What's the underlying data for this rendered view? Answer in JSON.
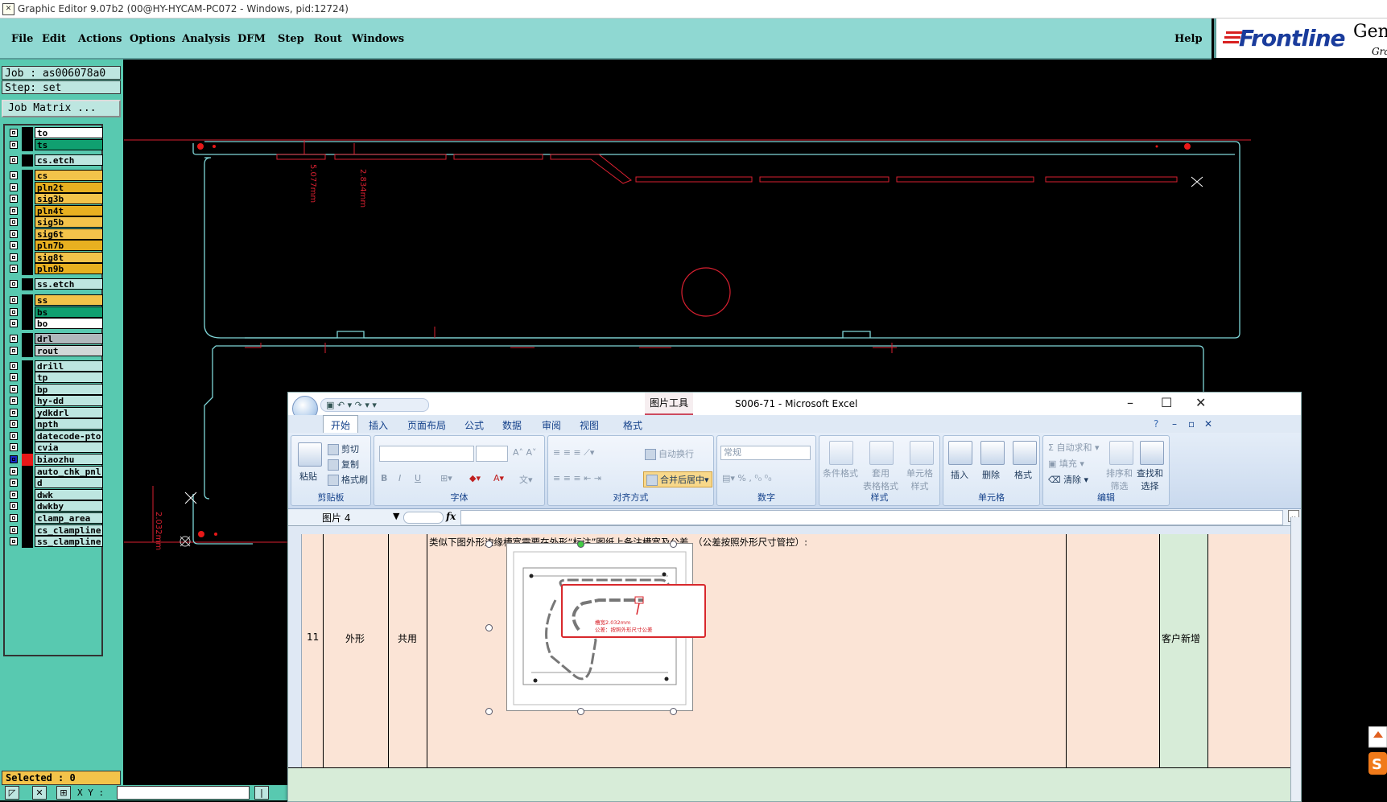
{
  "window": {
    "title": "Graphic Editor 9.07b2 (00@HY-HYCAM-PC072 - Windows, pid:12724)"
  },
  "menu": {
    "items": [
      "File",
      "Edit",
      "Actions",
      "Options",
      "Analysis",
      "DFM",
      "Step",
      "Rout",
      "Windows"
    ],
    "help": "Help"
  },
  "logo": {
    "brand": "Frontline",
    "product": "Gene",
    "sub": "Gra"
  },
  "job": {
    "job_label": "Job : as006078a0",
    "step_label": "Step: set",
    "matrix_button": "Job Matrix ..."
  },
  "layers": [
    {
      "name": "to",
      "color": "#ffffff"
    },
    {
      "name": "ts",
      "color": "#10a070"
    },
    {
      "name": "cs.etch",
      "color": "#bde6e0"
    },
    {
      "name": "cs",
      "color": "#f3c34a"
    },
    {
      "name": "pln2t",
      "color": "#e8b020"
    },
    {
      "name": "sig3b",
      "color": "#f3c34a"
    },
    {
      "name": "pln4t",
      "color": "#e8b020"
    },
    {
      "name": "sig5b",
      "color": "#f3c34a"
    },
    {
      "name": "sig6t",
      "color": "#f3c34a"
    },
    {
      "name": "pln7b",
      "color": "#e8b020"
    },
    {
      "name": "sig8t",
      "color": "#f3c34a"
    },
    {
      "name": "pln9b",
      "color": "#e8b020"
    },
    {
      "name": "ss.etch",
      "color": "#bde6e0"
    },
    {
      "name": "ss",
      "color": "#f3c34a"
    },
    {
      "name": "bs",
      "color": "#10a070"
    },
    {
      "name": "bo",
      "color": "#ffffff"
    },
    {
      "name": "drl",
      "color": "#b0b8bc"
    },
    {
      "name": "rout",
      "color": "#d0d8d8"
    },
    {
      "name": "drill",
      "color": "#bde6e0"
    },
    {
      "name": "tp",
      "color": "#bde6e0"
    },
    {
      "name": "bp",
      "color": "#bde6e0"
    },
    {
      "name": "hy-dd",
      "color": "#bde6e0"
    },
    {
      "name": "ydkdrl",
      "color": "#bde6e0"
    },
    {
      "name": "npth",
      "color": "#bde6e0"
    },
    {
      "name": "datecode-pto",
      "color": "#bde6e0"
    },
    {
      "name": "cvia",
      "color": "#bde6e0"
    },
    {
      "name": "biaozhu",
      "color": "#bde6e0",
      "active": true
    },
    {
      "name": "auto_chk_pnl",
      "color": "#bde6e0"
    },
    {
      "name": "d",
      "color": "#bde6e0"
    },
    {
      "name": "dwk",
      "color": "#bde6e0"
    },
    {
      "name": "dwkby",
      "color": "#bde6e0"
    },
    {
      "name": "clamp_area",
      "color": "#bde6e0"
    },
    {
      "name": "cs_clampline",
      "color": "#bde6e0"
    },
    {
      "name": "ss_clampline",
      "color": "#bde6e0"
    }
  ],
  "status": {
    "selected": "Selected : 0",
    "xy_label": "X Y :"
  },
  "canvas": {
    "dim_labels": [
      "5.077mm",
      "2.834mm",
      "2.032mm"
    ]
  },
  "excel": {
    "title": "S006-71 - Microsoft Excel",
    "tool_tab": "图片工具",
    "tabs": [
      "开始",
      "插入",
      "页面布局",
      "公式",
      "数据",
      "审阅",
      "视图",
      "格式"
    ],
    "ribbon": {
      "clipboard": {
        "label": "剪贴板",
        "paste": "粘贴",
        "cut": "剪切",
        "copy": "复制",
        "format_painter": "格式刷"
      },
      "font": {
        "label": "字体"
      },
      "alignment": {
        "label": "对齐方式",
        "wrap": "自动换行",
        "merge": "合并后居中"
      },
      "number": {
        "label": "数字",
        "format": "常规"
      },
      "styles": {
        "label": "样式",
        "conditional": "条件格式",
        "table": "套用\n表格格式",
        "cell": "单元格\n样式"
      },
      "cells": {
        "label": "单元格",
        "insert": "插入",
        "delete": "删除",
        "format": "格式"
      },
      "editing": {
        "label": "编辑",
        "autosum": "自动求和",
        "fill": "填充",
        "clear": "清除",
        "sort": "排序和\n筛选",
        "find": "查找和\n选择"
      }
    },
    "namebox": "图片 4",
    "formula_fx": "fx",
    "row": {
      "number": "11",
      "category": "外形",
      "scope": "共用",
      "description": "类似下图外形边缘槽宽需要在外形“标注”图纸上备注槽宽及公差。（公差按照外形尺寸管控）:",
      "note": "客户新增"
    },
    "picture_callout": {
      "line1": "槽宽2.032mm",
      "line2": "公差：按照外形尺寸公差"
    }
  }
}
